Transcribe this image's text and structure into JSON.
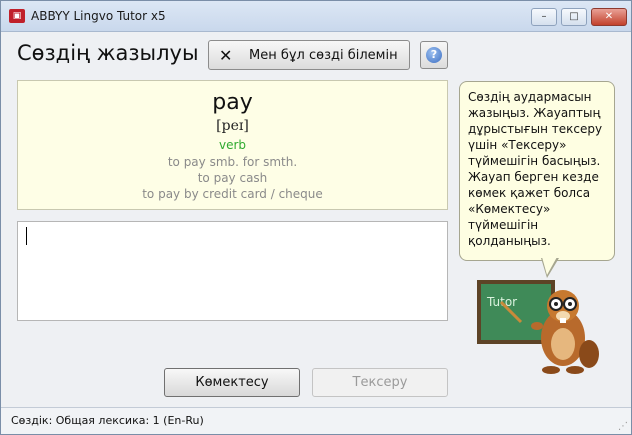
{
  "window": {
    "title": "ABBYY Lingvo Tutor x5",
    "icon": "app-logo-icon",
    "controls": {
      "minimize": "–",
      "maximize": "□",
      "close": "✕"
    }
  },
  "header": {
    "title": "Сөздің жазылуы",
    "dont_know_label": "Мен бұл сөзді білемін",
    "dont_know_icon": "x-icon",
    "help_icon": "help-icon"
  },
  "card": {
    "word": "pay",
    "transcription": "[peɪ]",
    "part_of_speech": "verb",
    "examples": [
      "to pay smb. for smth.",
      "to pay cash",
      "to pay by credit card / cheque"
    ]
  },
  "answer": {
    "value": ""
  },
  "buttons": {
    "hint_label": "Көмектесу",
    "check_label": "Тексеру"
  },
  "tip": {
    "text": "Сөздің аудармасын жазыңыз. Жауаптың дұрыстығын тексеру үшін «Тексеру» түймешігін басыңыз. Жауап берген кезде көмек қажет болса «Көмектесу» түймешігін қолданыңыз."
  },
  "mascot": {
    "board_text": "Tutor"
  },
  "status": {
    "text": "Сөздік: Общая лексика: 1 (En-Ru)"
  },
  "colors": {
    "pos_green": "#2faa2f",
    "card_bg": "#fefee6",
    "bubble_bg": "#fefee2"
  }
}
